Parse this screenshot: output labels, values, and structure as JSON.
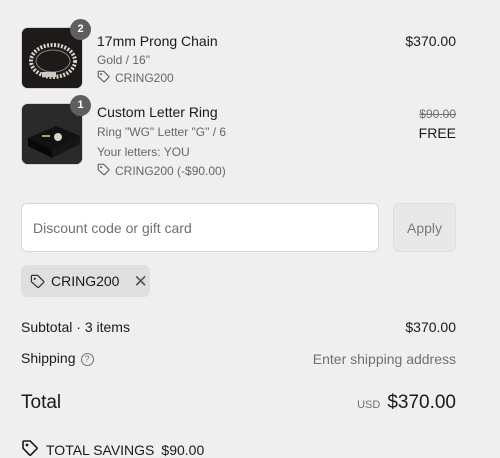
{
  "line_items": [
    {
      "quantity": "2",
      "title": "17mm Prong Chain",
      "variant": "Gold / 16\"",
      "code": "CRING200",
      "price": "$370.00"
    },
    {
      "quantity": "1",
      "title": "Custom Letter Ring",
      "variant": "Ring \"WG\" Letter \"G\" / 6",
      "custom_text": "Your letters: YOU",
      "code": "CRING200 (-$90.00)",
      "original_price": "$90.00",
      "price": "FREE"
    }
  ],
  "discount": {
    "placeholder": "Discount code or gift card",
    "apply_label": "Apply",
    "applied_code": "CRING200"
  },
  "summary": {
    "subtotal_label": "Subtotal · 3 items",
    "subtotal_value": "$370.00",
    "shipping_label": "Shipping",
    "shipping_value": "Enter shipping address",
    "total_label": "Total",
    "currency": "USD",
    "total_value": "$370.00",
    "savings_label": "TOTAL SAVINGS",
    "savings_value": "$90.00"
  },
  "icons": {
    "tag": "tag-icon",
    "help": "help-circle-icon",
    "remove": "close-icon",
    "savings": "savings-tag-icon"
  }
}
